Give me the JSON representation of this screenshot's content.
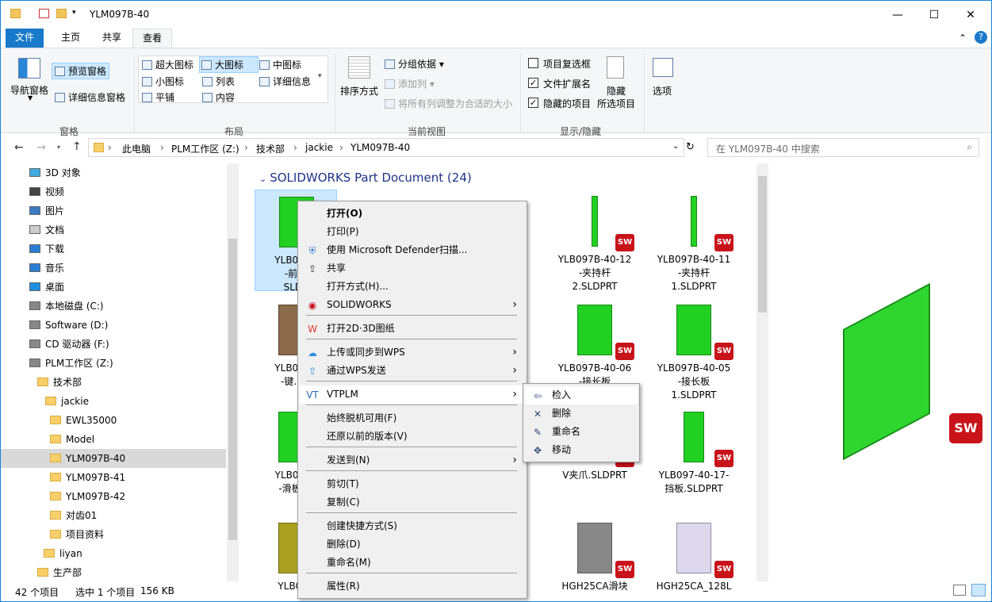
{
  "window": {
    "title": "YLM097B-40",
    "minimize": "—",
    "maximize": "☐",
    "close": "✕",
    "help": "?"
  },
  "tabs": [
    "文件",
    "主页",
    "共享",
    "查看"
  ],
  "ribbon": {
    "pane": {
      "nav": "导航窗格",
      "preview": "预览窗格",
      "details": "详细信息窗格",
      "group": "窗格"
    },
    "layout": {
      "items": [
        "超大图标",
        "大图标",
        "中图标",
        "小图标",
        "列表",
        "详细信息",
        "平铺",
        "内容"
      ],
      "group": "布局"
    },
    "view": {
      "sort": "排序方式",
      "groupby": "分组依据",
      "addcol": "添加列",
      "fit": "将所有列调整为合适的大小",
      "group": "当前视图"
    },
    "show": {
      "checkboxes": "项目复选框",
      "extensions": "文件扩展名",
      "hidden": "隐藏的项目",
      "hide1": "隐藏",
      "hide2": "所选项目",
      "group": "显示/隐藏"
    },
    "options": "选项"
  },
  "address": {
    "crumbs": [
      "此电脑",
      "PLM工作区 (Z:)",
      "技术部",
      "jackie",
      "YLM097B-40"
    ],
    "search_placeholder": "在 YLM097B-40 中搜索"
  },
  "nav": [
    "3D 对象",
    "视频",
    "图片",
    "文档",
    "下载",
    "音乐",
    "桌面",
    "本地磁盘 (C:)",
    "Software (D:)",
    "CD 驱动器 (F:)",
    "PLM工作区 (Z:)",
    "技术部",
    "jackie",
    "EWL35000",
    "Model",
    "YLM097B-40",
    "YLM097B-41",
    "YLM097B-42",
    "对齿01",
    "项目资料",
    "liyan",
    "生产部"
  ],
  "group_header": "SOLIDWORKS Part Document (24)",
  "files": [
    {
      "l1": "YLB097B",
      "l2": "-前连",
      "l3": "SLDP"
    },
    {
      "l1": "YLB097B-40-12",
      "l2": "-夹持杆",
      "l3": "2.SLDPRT"
    },
    {
      "l1": "YLB097B-40-11",
      "l2": "-夹持杆",
      "l3": "1.SLDPRT"
    },
    {
      "l1": "YLB097B",
      "l2": "-键.SLI",
      "l3": ""
    },
    {
      "l1": "YLB097B-40-06",
      "l2": "-接长板",
      "l3": "2.SLDPRT"
    },
    {
      "l1": "YLB097B-40-05",
      "l2": "-接长板",
      "l3": "1.SLDPRT"
    },
    {
      "l1": "YLB097E",
      "l2": "-滑板.SI",
      "l3": ""
    },
    {
      "l1": "",
      "l2": "V夹爪.SLDPRT",
      "l3": ""
    },
    {
      "l1": "YLB097-40-17-",
      "l2": "挡板.SLDPRT",
      "l3": ""
    },
    {
      "l1": "YLB097",
      "l2": "",
      "l3": ""
    },
    {
      "l1": "HGH25CA滑块",
      "l2": "",
      "l3": ""
    },
    {
      "l1": "HGH25CA_128L",
      "l2": "",
      "l3": ""
    }
  ],
  "sw_badge": "SW",
  "menu": [
    "打开(O)",
    "打印(P)",
    "使用 Microsoft Defender扫描...",
    "共享",
    "打开方式(H)...",
    "SOLIDWORKS",
    "打开2D·3D图纸",
    "上传或同步到WPS",
    "通过WPS发送",
    "VTPLM",
    "始终脱机可用(F)",
    "还原以前的版本(V)",
    "发送到(N)",
    "剪切(T)",
    "复制(C)",
    "创建快捷方式(S)",
    "删除(D)",
    "重命名(M)",
    "属性(R)"
  ],
  "submenu": [
    "检入",
    "删除",
    "重命名",
    "移动"
  ],
  "status": {
    "count": "42 个项目",
    "selected": "选中 1 个项目",
    "size": "156 KB"
  }
}
